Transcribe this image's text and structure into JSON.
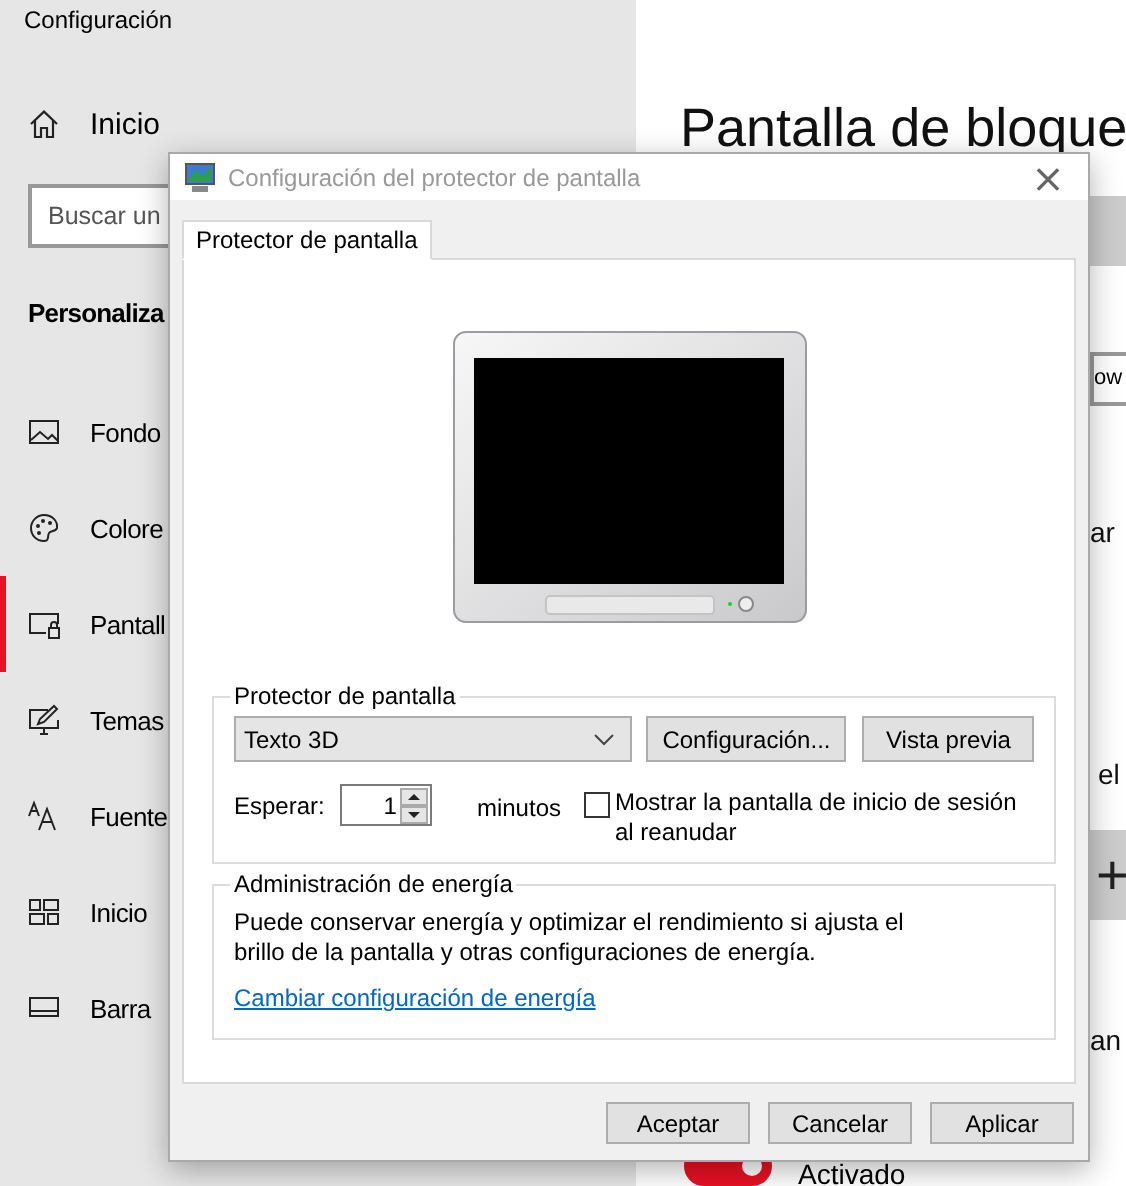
{
  "settings": {
    "title": "Configuración",
    "home": "Inicio",
    "search": {
      "placeholder": "Buscar un"
    },
    "section": "Personaliza",
    "items": [
      {
        "label": "Fondo",
        "selected": false
      },
      {
        "label": "Colore",
        "selected": false
      },
      {
        "label": "Pantall",
        "selected": true
      },
      {
        "label": "Temas",
        "selected": false
      },
      {
        "label": "Fuente",
        "selected": false
      },
      {
        "label": "Inicio",
        "selected": false
      },
      {
        "label": "Barra",
        "selected": false
      }
    ]
  },
  "page": {
    "heading": "Pantalla de bloque",
    "field_value": "ow",
    "text_1": "ar",
    "text_2": "el",
    "add_button": "+",
    "text_3": "an",
    "toggle": {
      "on": true,
      "label": "Activado"
    }
  },
  "dialog": {
    "title": "Configuración del protector de pantalla",
    "close": "×",
    "tabs": [
      {
        "label": "Protector de pantalla",
        "selected": true
      }
    ],
    "saver": {
      "legend": "Protector de pantalla",
      "combo_value": "Texto 3D",
      "buttons": [
        "Configuración...",
        "Vista previa"
      ],
      "wait_label": "Esperar:",
      "wait_value": "1",
      "unit": "minutos",
      "logon": {
        "label": "Mostrar la pantalla de inicio de sesión al reanudar",
        "checked": false
      }
    },
    "power": {
      "legend": "Administración de energía",
      "text": "Puede conservar energía y optimizar el rendimiento si ajusta el brillo de la pantalla y otras configuraciones de energía.",
      "link": "Cambiar configuración de energía"
    },
    "buttons": [
      "Aceptar",
      "Cancelar",
      "Aplicar"
    ]
  }
}
